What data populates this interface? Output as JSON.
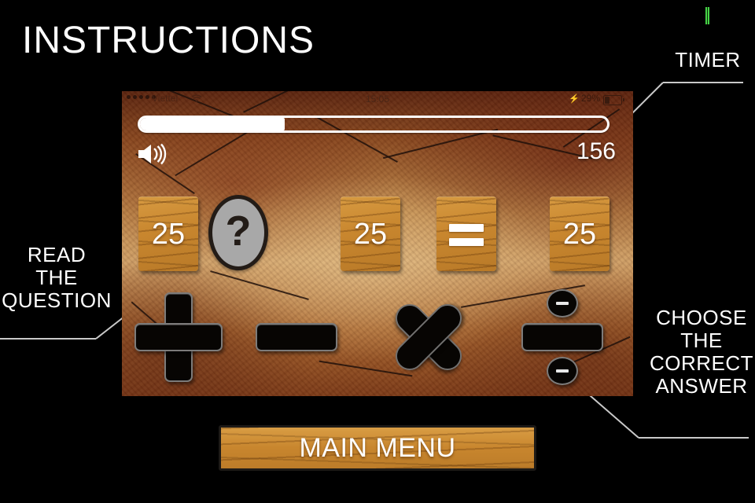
{
  "page": {
    "title": "INSTRUCTIONS",
    "background_color": "#000000",
    "text_color": "#ffffff"
  },
  "annotations": [
    {
      "id": "timer",
      "label": "TIMER"
    },
    {
      "id": "read",
      "label": "READ\nTHE\nQUESTION",
      "lines": [
        "READ",
        "THE",
        "QUESTION"
      ]
    },
    {
      "id": "choose",
      "label": "CHOOSE\nTHE\nCORRECT\nANSWER",
      "lines": [
        "CHOOSE",
        "THE",
        "CORRECT",
        "ANSWER"
      ]
    }
  ],
  "annotation_lines": {
    "timer_label": "TIMER",
    "read_line1": "READ",
    "read_line2": "THE",
    "read_line3": "QUESTION",
    "choose_line1": "CHOOSE",
    "choose_line2": "THE",
    "choose_line3": "CORRECT",
    "choose_line4": "ANSWER"
  },
  "game_screen": {
    "status_bar": {
      "signal_dots": 5,
      "carrier": "Viettel",
      "wifi_icon": "wifi-icon",
      "time": "15:05",
      "battery_percent": "29%",
      "battery_level": 29,
      "charging_icon": "bolt-icon"
    },
    "timer": {
      "name": "timer-bar",
      "fill_percent": 31,
      "fill_color": "#ffffff",
      "border_color": "#ffffff"
    },
    "sound_icon": "speaker-icon",
    "score": "156",
    "equation": [
      {
        "kind": "tile",
        "value": "25",
        "name": "answer-tile-1"
      },
      {
        "kind": "question",
        "value": "?",
        "name": "question-mark-badge"
      },
      {
        "kind": "tile",
        "value": "25",
        "name": "answer-tile-2"
      },
      {
        "kind": "tile",
        "value": "=",
        "name": "equals-tile"
      },
      {
        "kind": "tile",
        "value": "25",
        "name": "answer-tile-3"
      }
    ],
    "operators": [
      {
        "symbol": "+",
        "name": "operator-plus-button"
      },
      {
        "symbol": "−",
        "name": "operator-minus-button"
      },
      {
        "symbol": "×",
        "name": "operator-multiply-button"
      },
      {
        "symbol": "÷",
        "name": "operator-divide-button"
      }
    ],
    "colors": {
      "tile_wood": "#c8862e",
      "operator_black": "#070503",
      "question_disc": "#a8a8a8"
    }
  },
  "main_menu_button": {
    "label": "MAIN MENU"
  }
}
